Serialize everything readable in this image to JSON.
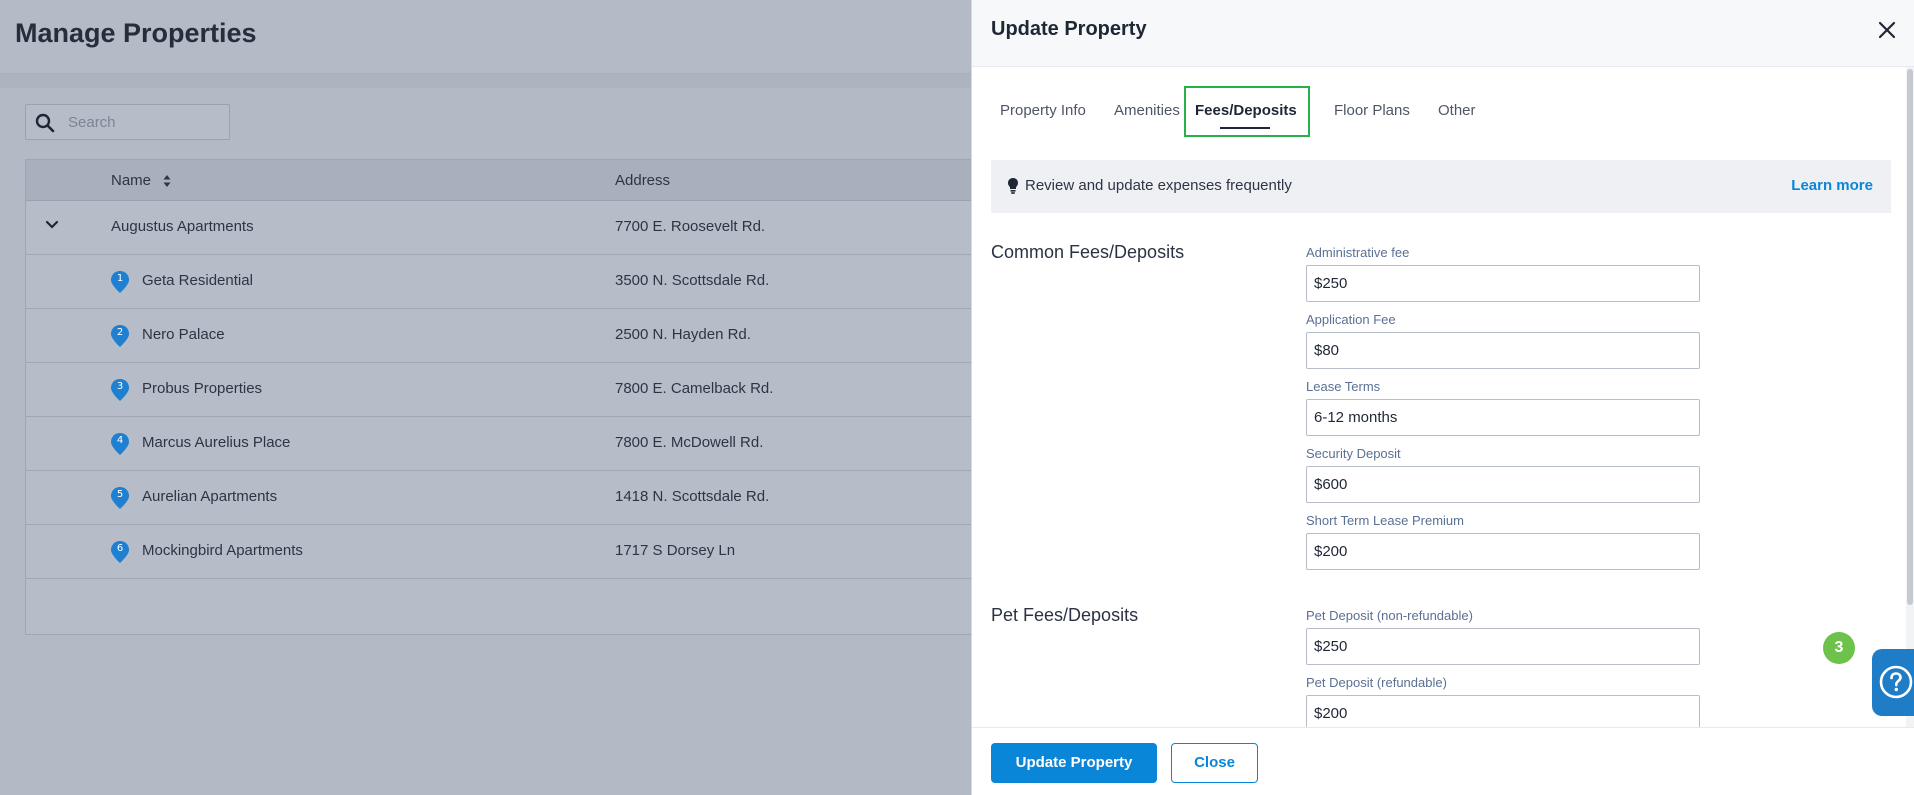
{
  "page": {
    "title": "Manage Properties",
    "search_placeholder": "Search"
  },
  "table": {
    "columns": [
      "Name",
      "Address"
    ],
    "rows": [
      {
        "name": "Augustus Apartments",
        "address": "7700 E. Roosevelt Rd.",
        "pin": ""
      },
      {
        "name": "Geta Residential",
        "address": "3500 N. Scottsdale Rd.",
        "pin": "1"
      },
      {
        "name": "Nero Palace",
        "address": "2500 N. Hayden Rd.",
        "pin": "2"
      },
      {
        "name": "Probus Properties",
        "address": "7800 E. Camelback Rd.",
        "pin": "3"
      },
      {
        "name": "Marcus Aurelius Place",
        "address": "7800 E. McDowell Rd.",
        "pin": "4"
      },
      {
        "name": "Aurelian Apartments",
        "address": "1418 N. Scottsdale Rd.",
        "pin": "5"
      },
      {
        "name": "Mockingbird Apartments",
        "address": "1717 S Dorsey Ln",
        "pin": "6"
      }
    ]
  },
  "panel": {
    "title": "Update Property",
    "tabs": [
      "Property Info",
      "Amenities",
      "Fees/Deposits",
      "Floor Plans",
      "Other"
    ],
    "active_tab": "Fees/Deposits",
    "tip": {
      "text": "Review and update expenses frequently",
      "link": "Learn more"
    },
    "sections": [
      {
        "title": "Common Fees/Deposits",
        "fields": [
          {
            "label": "Administrative fee",
            "value": "$250"
          },
          {
            "label": "Application Fee",
            "value": "$80"
          },
          {
            "label": "Lease Terms",
            "value": "6-12 months"
          },
          {
            "label": "Security Deposit",
            "value": "$600"
          },
          {
            "label": "Short Term Lease Premium",
            "value": "$200"
          }
        ]
      },
      {
        "title": "Pet Fees/Deposits",
        "fields": [
          {
            "label": "Pet Deposit (non-refundable)",
            "value": "$250"
          },
          {
            "label": "Pet Deposit (refundable)",
            "value": "$200"
          }
        ]
      }
    ],
    "footer": {
      "primary": "Update Property",
      "secondary": "Close"
    }
  },
  "help": {
    "badge": "3"
  },
  "colors": {
    "accent": "#0a86d8",
    "active_tab_border": "#26b14a",
    "pin": "#1f7fd0",
    "help_badge": "#6cc24a",
    "overlay_bg": "#b3bac6"
  }
}
